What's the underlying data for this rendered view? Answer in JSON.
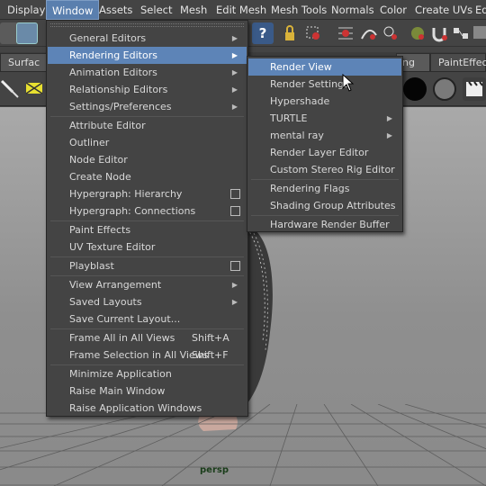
{
  "menubar": {
    "items": [
      "Display",
      "Window",
      "Assets",
      "Select",
      "Mesh",
      "Edit Mesh",
      "Mesh Tools",
      "Normals",
      "Color",
      "Create UVs",
      "Ed"
    ],
    "active": "Window"
  },
  "shelf": {
    "tab_left": "Surfac",
    "tab_right_a": "ng",
    "tab_right_b": "PaintEffec"
  },
  "window_menu": [
    {
      "label": "General Editors",
      "submenu": true
    },
    {
      "label": "Rendering Editors",
      "submenu": true,
      "highlighted": true
    },
    {
      "label": "Animation Editors",
      "submenu": true
    },
    {
      "label": "Relationship Editors",
      "submenu": true
    },
    {
      "label": "Settings/Preferences",
      "submenu": true
    },
    {
      "label": "Attribute Editor"
    },
    {
      "label": "Outliner"
    },
    {
      "label": "Node Editor"
    },
    {
      "label": "Create Node"
    },
    {
      "label": "Hypergraph: Hierarchy",
      "option_box": true
    },
    {
      "label": "Hypergraph: Connections",
      "option_box": true
    },
    {
      "label": "Paint Effects"
    },
    {
      "label": "UV Texture Editor"
    },
    {
      "label": "Playblast",
      "option_box": true
    },
    {
      "label": "View Arrangement",
      "submenu": true
    },
    {
      "label": "Saved Layouts",
      "submenu": true
    },
    {
      "label": "Save Current Layout..."
    },
    {
      "label": "Frame All in All Views",
      "shortcut": "Shift+A"
    },
    {
      "label": "Frame Selection in All Views",
      "shortcut": "Shift+F"
    },
    {
      "label": "Minimize Application"
    },
    {
      "label": "Raise Main Window"
    },
    {
      "label": "Raise Application Windows"
    }
  ],
  "rendering_editors_submenu": [
    {
      "label": "Render View",
      "highlighted": true
    },
    {
      "label": "Render Settings"
    },
    {
      "label": "Hypershade"
    },
    {
      "label": "TURTLE",
      "submenu": true
    },
    {
      "label": "mental ray",
      "submenu": true
    },
    {
      "label": "Render Layer Editor"
    },
    {
      "label": "Custom Stereo Rig Editor"
    },
    {
      "label": "Rendering Flags"
    },
    {
      "label": "Shading Group Attributes"
    },
    {
      "label": "Hardware Render Buffer"
    }
  ],
  "viewport": {
    "camera_label": "persp"
  },
  "icons": {
    "help": "?",
    "submenu_arrow": "▶"
  }
}
